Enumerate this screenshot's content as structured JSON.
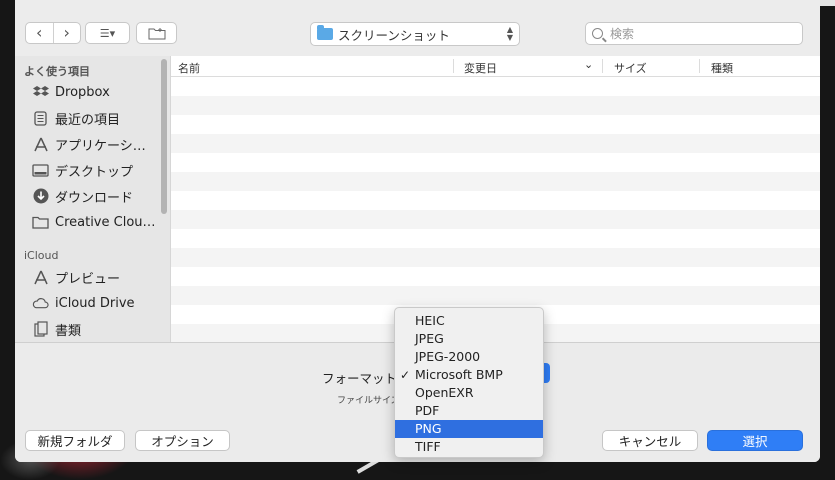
{
  "toolbar": {
    "back_glyph": "‹",
    "forward_glyph": "›",
    "view_glyph": "☰▾",
    "location": "スクリーンショット",
    "search_placeholder": "検索"
  },
  "sidebar": {
    "favorites_header": "よく使う項目",
    "favorites": [
      {
        "label": "Dropbox",
        "icon": "dropbox-icon"
      },
      {
        "label": "最近の項目",
        "icon": "recents-icon"
      },
      {
        "label": "アプリケーシ…",
        "icon": "applications-icon"
      },
      {
        "label": "デスクトップ",
        "icon": "desktop-icon"
      },
      {
        "label": "ダウンロード",
        "icon": "downloads-icon"
      },
      {
        "label": "Creative Clou…",
        "icon": "folder-icon"
      }
    ],
    "icloud_header": "iCloud",
    "icloud": [
      {
        "label": "プレビュー",
        "icon": "preview-icon"
      },
      {
        "label": "iCloud Drive",
        "icon": "cloud-icon"
      },
      {
        "label": "書類",
        "icon": "documents-icon"
      }
    ]
  },
  "file_list": {
    "columns": {
      "name": "名前",
      "modified": "変更日",
      "size": "サイズ",
      "kind": "種類"
    }
  },
  "options": {
    "format_label": "フォーマット",
    "file_size_label": "ファイルサイズ"
  },
  "format_menu": {
    "items": [
      "HEIC",
      "JPEG",
      "JPEG-2000",
      "Microsoft BMP",
      "OpenEXR",
      "PDF",
      "PNG",
      "TIFF"
    ],
    "checked": "Microsoft BMP",
    "highlighted": "PNG"
  },
  "buttons": {
    "new_folder": "新規フォルダ",
    "options": "オプション",
    "cancel": "キャンセル",
    "choose": "選択"
  },
  "colors": {
    "accent": "#2f7ef6",
    "highlight": "#2f6fe0",
    "folder": "#5aa9e6"
  }
}
